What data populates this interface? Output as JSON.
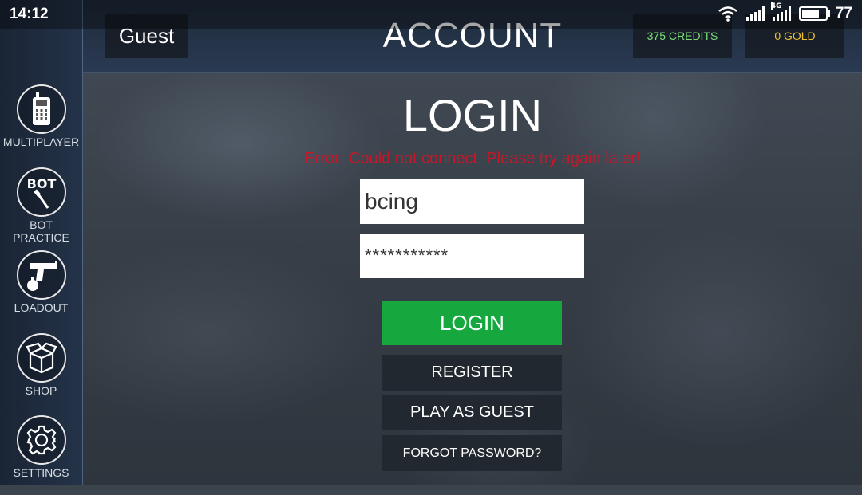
{
  "status_bar": {
    "time": "14:12",
    "network": "4G",
    "battery": "77",
    "battery_level": 0.77
  },
  "header": {
    "user": "Guest",
    "title": "ACCOUNT",
    "credits": "375 CREDITS",
    "gold": "0 GOLD"
  },
  "sidebar": {
    "items": [
      {
        "label": "MULTIPLAYER",
        "icon": "walkie-talkie-icon"
      },
      {
        "label": "BOT PRACTICE",
        "icon": "bot-knife-icon",
        "badge": "BOT"
      },
      {
        "label": "LOADOUT",
        "icon": "pistol-grenade-icon"
      },
      {
        "label": "SHOP",
        "icon": "box-icon"
      },
      {
        "label": "SETTINGS",
        "icon": "gear-icon"
      }
    ]
  },
  "login": {
    "title": "LOGIN",
    "error": "Error: Could not connect. Please try again later!",
    "username": "bcing",
    "password_mask": "***********",
    "login_label": "LOGIN",
    "register_label": "REGISTER",
    "guest_label": "PLAY AS GUEST",
    "forgot_label": "FORGOT PASSWORD?"
  },
  "colors": {
    "accent_green": "#16a83e",
    "credits_green": "#7ee07a",
    "gold_yellow": "#f0c232",
    "error_red": "#c4182a"
  }
}
